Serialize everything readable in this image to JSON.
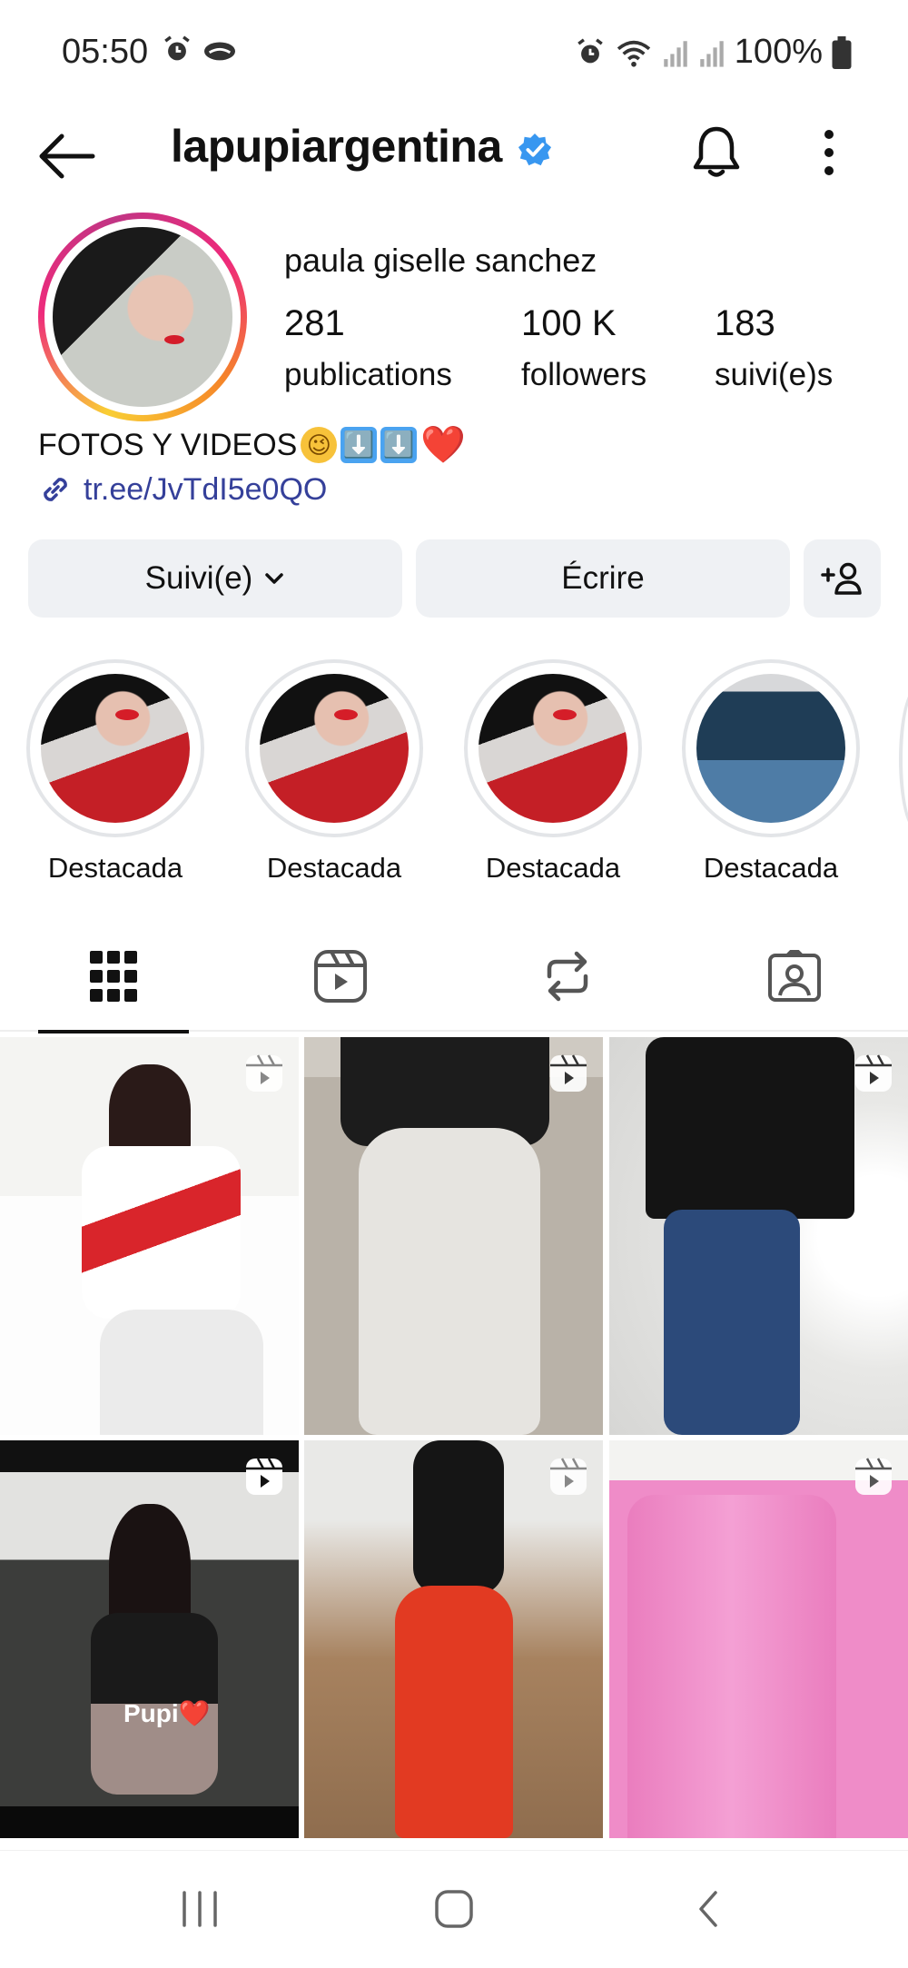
{
  "status_bar": {
    "time": "05:50",
    "battery": "100%",
    "left_icons": [
      "alarm-icon",
      "cloud-icon"
    ],
    "right_icons": [
      "alarm-icon",
      "wifi-icon",
      "signal-icon",
      "signal-icon",
      "battery-icon"
    ]
  },
  "header": {
    "username": "lapupiargentina",
    "verified": true,
    "icons": [
      "back-arrow-icon",
      "verified-badge-icon",
      "bell-icon",
      "more-vertical-icon"
    ]
  },
  "profile": {
    "full_name": "paula giselle sanchez",
    "stats": [
      {
        "value": "281",
        "label": "publications"
      },
      {
        "value": "100 K",
        "label": "followers"
      },
      {
        "value": "183",
        "label": "suivi(e)s"
      }
    ],
    "bio_text": "FOTOS Y VIDEOS",
    "bio_emojis": [
      "😉",
      "⬇️",
      "⬇️",
      "❤️"
    ],
    "link": "tr.ee/JvTdI5e0QO"
  },
  "actions": {
    "follow_label": "Suivi(e)",
    "message_label": "Écrire"
  },
  "highlights": [
    {
      "label": "Destacada"
    },
    {
      "label": "Destacada"
    },
    {
      "label": "Destacada"
    },
    {
      "label": "Destacada"
    }
  ],
  "tabs": [
    "grid-icon",
    "reels-icon",
    "reposts-icon",
    "tagged-icon"
  ],
  "posts": [
    {
      "type": "reel"
    },
    {
      "type": "reel"
    },
    {
      "type": "reel"
    },
    {
      "type": "reel",
      "overlay_text": "Pupi❤️"
    },
    {
      "type": "reel"
    },
    {
      "type": "reel"
    }
  ],
  "colors": {
    "accent_link": "#35409a",
    "verified_blue": "#3897f0",
    "button_bg": "#eff1f4"
  }
}
